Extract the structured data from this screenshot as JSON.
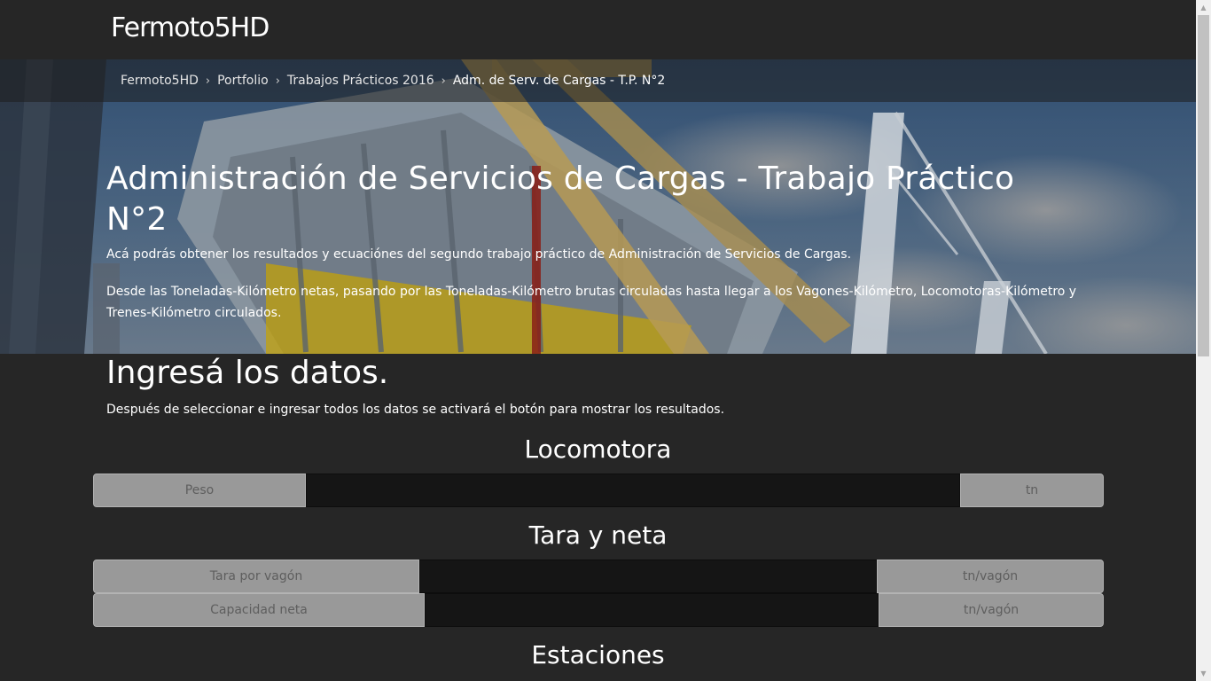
{
  "header": {
    "brand": "Fermoto5HD"
  },
  "breadcrumb": {
    "items": [
      "Fermoto5HD",
      "Portfolio",
      "Trabajos Prácticos 2016"
    ],
    "current": "Adm. de Serv. de Cargas - T.P. N°2",
    "separator": "›"
  },
  "hero": {
    "title": "Administración de Servicios de Cargas - Trabajo Práctico N°2",
    "paragraph1": "Acá podrás obtener los resultados y ecuaciónes del segundo trabajo práctico de Administración de Servicios de Cargas.",
    "paragraph2": "Desde las Toneladas-Kilómetro netas, pasando por las Toneladas-Kilómetro brutas circuladas hasta llegar a los Vagones-Kilómetro, Locomotoras-Kilómetro y Trenes-Kilómetro circulados."
  },
  "form": {
    "title": "Ingresá los datos.",
    "subtitle": "Después de seleccionar e ingresar todos los datos se activará el botón para mostrar los resultados.",
    "locomotora": {
      "title": "Locomotora",
      "peso": {
        "label": "Peso",
        "value": "",
        "unit": "tn"
      }
    },
    "tara_neta": {
      "title": "Tara y neta",
      "tara": {
        "label": "Tara por vagón",
        "value": "",
        "unit": "tn/vagón"
      },
      "capacidad": {
        "label": "Capacidad neta",
        "value": "",
        "unit": "tn/vagón"
      }
    },
    "estaciones": {
      "title": "Estaciones"
    }
  },
  "colors": {
    "background": "#262626",
    "addon": "#999999",
    "addon_text": "#5e5e5e",
    "field": "#151515"
  }
}
